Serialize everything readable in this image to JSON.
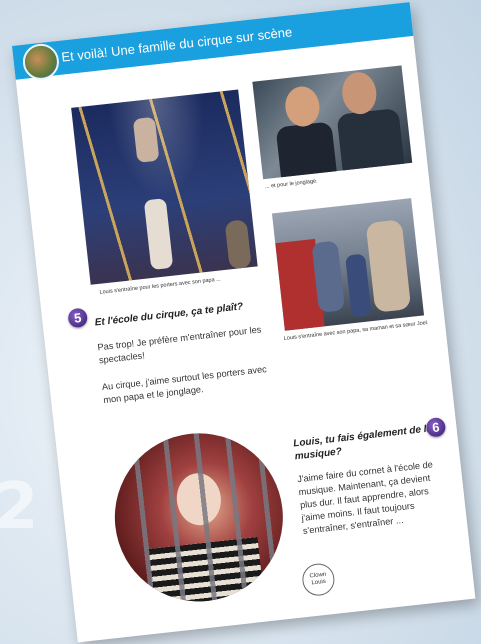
{
  "watermark": "2",
  "header": {
    "title": "Et voilà! Une famille du cirque sur scène"
  },
  "captions": {
    "photo1": "Louis s'entraîne pour les porters avec son papa ...",
    "photo2": "... et pour le jonglage.",
    "photo3": "Louis s'entraîne avec son papa, sa maman et sa sœur Joel."
  },
  "section5": {
    "number": "5",
    "question": "Et l'école du cirque, ça te plaît?",
    "para1": "Pas trop! Je préfère m'entraîner pour les spectacles!",
    "para2": "Au cirque, j'aime surtout les porters avec mon papa et le jonglage."
  },
  "section6": {
    "number": "6",
    "question": "Louis, tu fais également de la musique?",
    "para": "J'aime faire du cornet à l'école de musique. Maintenant, ça devient plus dur. Il faut apprendre, alors j'aime moins. Il faut toujours s'entraîner, s'entraîner ..."
  },
  "clown_label": {
    "line1": "Clown",
    "line2": "Louis"
  },
  "colors": {
    "header": "#1aa0de",
    "badge": "#5b3a9a"
  }
}
